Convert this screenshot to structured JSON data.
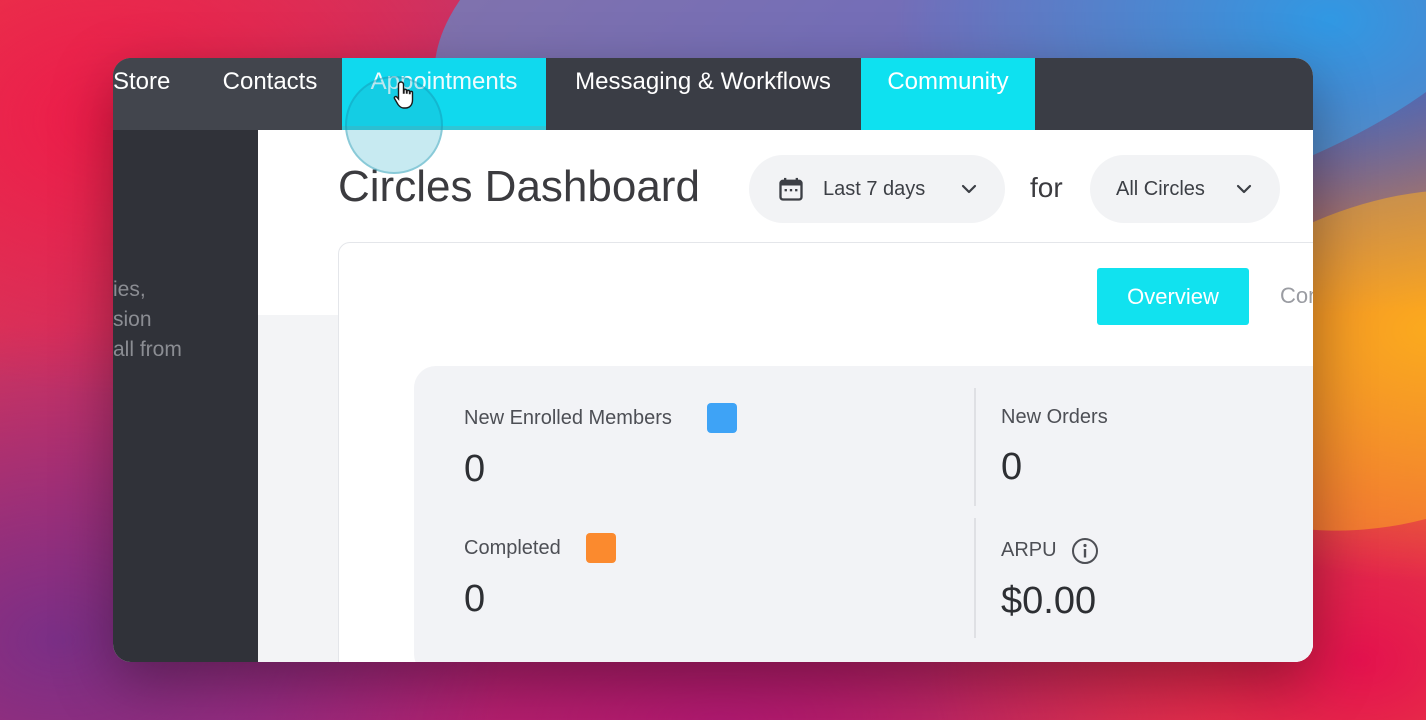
{
  "topnav": {
    "items": [
      {
        "label": "Store"
      },
      {
        "label": "Contacts"
      },
      {
        "label": "Appointments"
      },
      {
        "label": "Messaging & Workflows"
      },
      {
        "label": "Community"
      }
    ]
  },
  "sidebar": {
    "text_lines": [
      "ies,",
      "sion",
      "all from"
    ]
  },
  "dashboard": {
    "title": "Circles Dashboard",
    "date_filter": {
      "label": "Last 7 days",
      "icon": "calendar-icon"
    },
    "for_label": "for",
    "circle_filter": {
      "label": "All Circles"
    },
    "tabs": [
      {
        "label": "Overview",
        "active": true
      },
      {
        "label": "Con"
      }
    ]
  },
  "stats": {
    "new_enrolled_members": {
      "label": "New Enrolled Members",
      "value": "0",
      "color": "#3ea3f6"
    },
    "completed": {
      "label": "Completed",
      "value": "0",
      "color": "#fb8a2e"
    },
    "new_orders": {
      "label": "New Orders",
      "value": "0"
    },
    "arpu": {
      "label": "ARPU",
      "value": "$0.00",
      "icon": "info-icon"
    }
  },
  "colors": {
    "accent": "#10d9ee",
    "nav_bg": "#3a3d45",
    "sidebar_bg": "#303239"
  }
}
